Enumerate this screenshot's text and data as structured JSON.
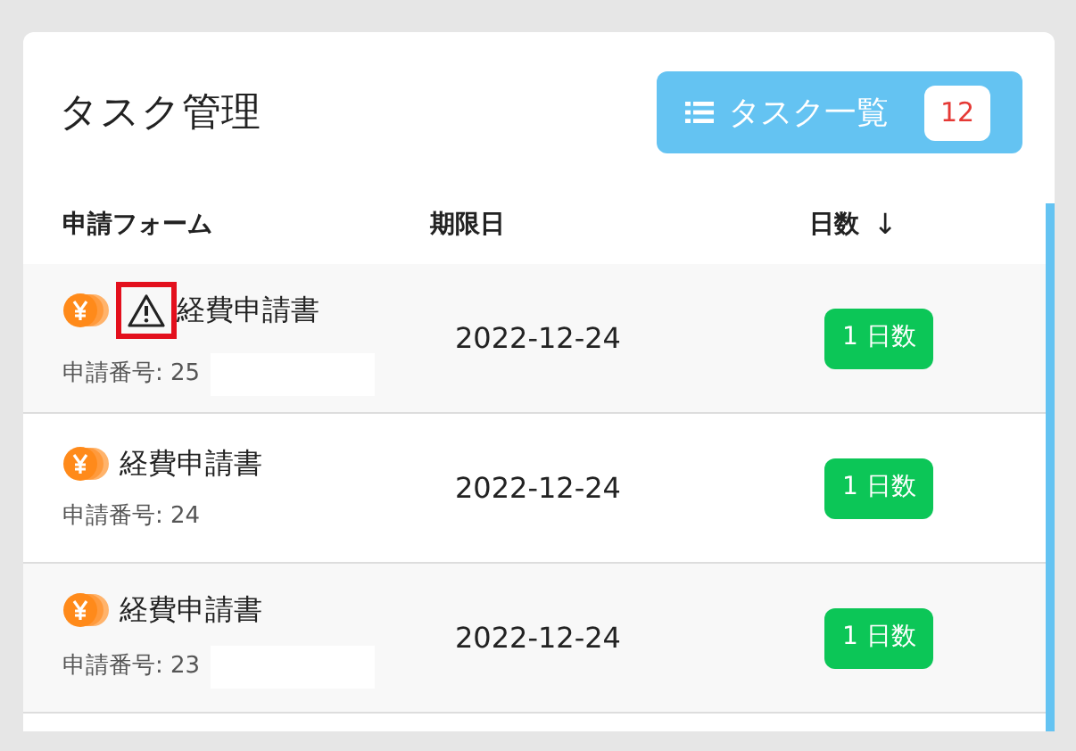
{
  "title": "タスク管理",
  "list_button": {
    "label": "タスク一覧",
    "count": "12"
  },
  "columns": [
    {
      "label": "申請フォーム"
    },
    {
      "label": "期限日"
    },
    {
      "label": "日数",
      "sort_icon": "↓"
    }
  ],
  "rows": [
    {
      "form": "経費申請書",
      "number": "申請番号: 25",
      "due": "2022-12-24",
      "days": "1 日数",
      "warning": true,
      "redacted": true
    },
    {
      "form": "経費申請書",
      "number": "申請番号: 24",
      "due": "2022-12-24",
      "days": "1 日数",
      "warning": false,
      "redacted": false
    },
    {
      "form": "経費申請書",
      "number": "申請番号: 23",
      "due": "2022-12-24",
      "days": "1 日数",
      "warning": false,
      "redacted": true
    }
  ]
}
